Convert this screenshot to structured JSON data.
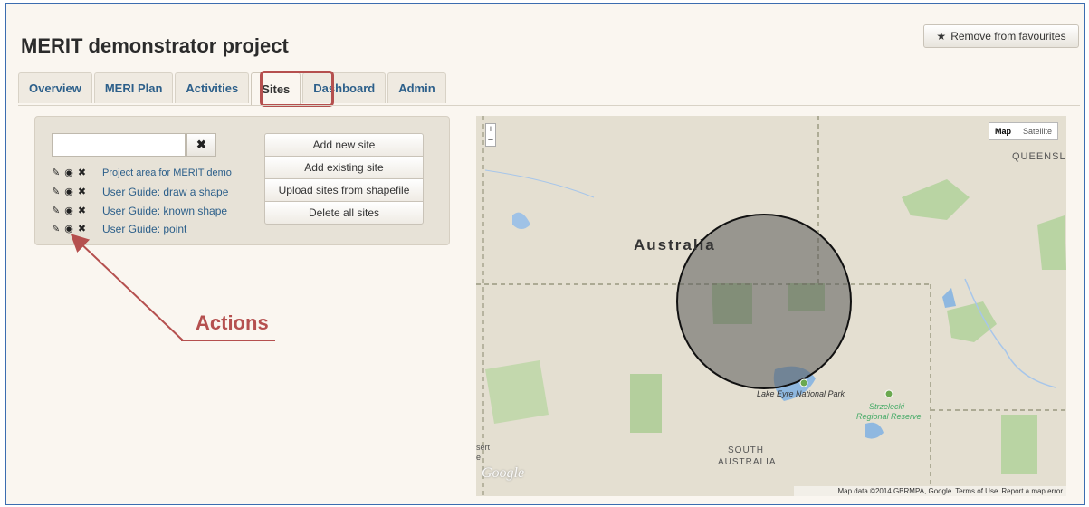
{
  "page": {
    "title": "MERIT demonstrator project",
    "favourite_label": "Remove from favourites"
  },
  "tabs": [
    {
      "label": "Overview"
    },
    {
      "label": "MERI Plan"
    },
    {
      "label": "Activities"
    },
    {
      "label": "Sites",
      "active": true
    },
    {
      "label": "Dashboard"
    },
    {
      "label": "Admin"
    }
  ],
  "sites": {
    "search": {
      "value": "",
      "placeholder": ""
    },
    "items": [
      {
        "label": "Project area for MERIT demo"
      },
      {
        "label": "User Guide: draw a shape"
      },
      {
        "label": "User Guide: known shape"
      },
      {
        "label": "User Guide: point"
      }
    ],
    "buttons": {
      "add_new": "Add new site",
      "add_existing": "Add existing site",
      "upload": "Upload sites from shapefile",
      "delete_all": "Delete all sites"
    }
  },
  "annotation": {
    "label": "Actions",
    "color": "#b5504f"
  },
  "map": {
    "type_map": "Map",
    "type_satellite": "Satellite",
    "zoom_in": "+",
    "zoom_out": "−",
    "labels": {
      "country": "Australia",
      "queensland": "QUEENSL",
      "south_australia_1": "SOUTH",
      "south_australia_2": "AUSTRALIA",
      "park": "Lake Eyre National Park",
      "strzelecki_1": "Strzelecki",
      "strzelecki_2": "Regional Reserve",
      "edge_1": "sert",
      "edge_2": "e",
      "google": "Google"
    },
    "footer": {
      "data": "Map data ©2014 GBRMPA, Google",
      "terms": "Terms of Use",
      "report": "Report a map error"
    }
  },
  "icons": {
    "edit": "edit-icon",
    "view": "eye-icon",
    "delete": "close-icon",
    "star": "star-icon"
  }
}
